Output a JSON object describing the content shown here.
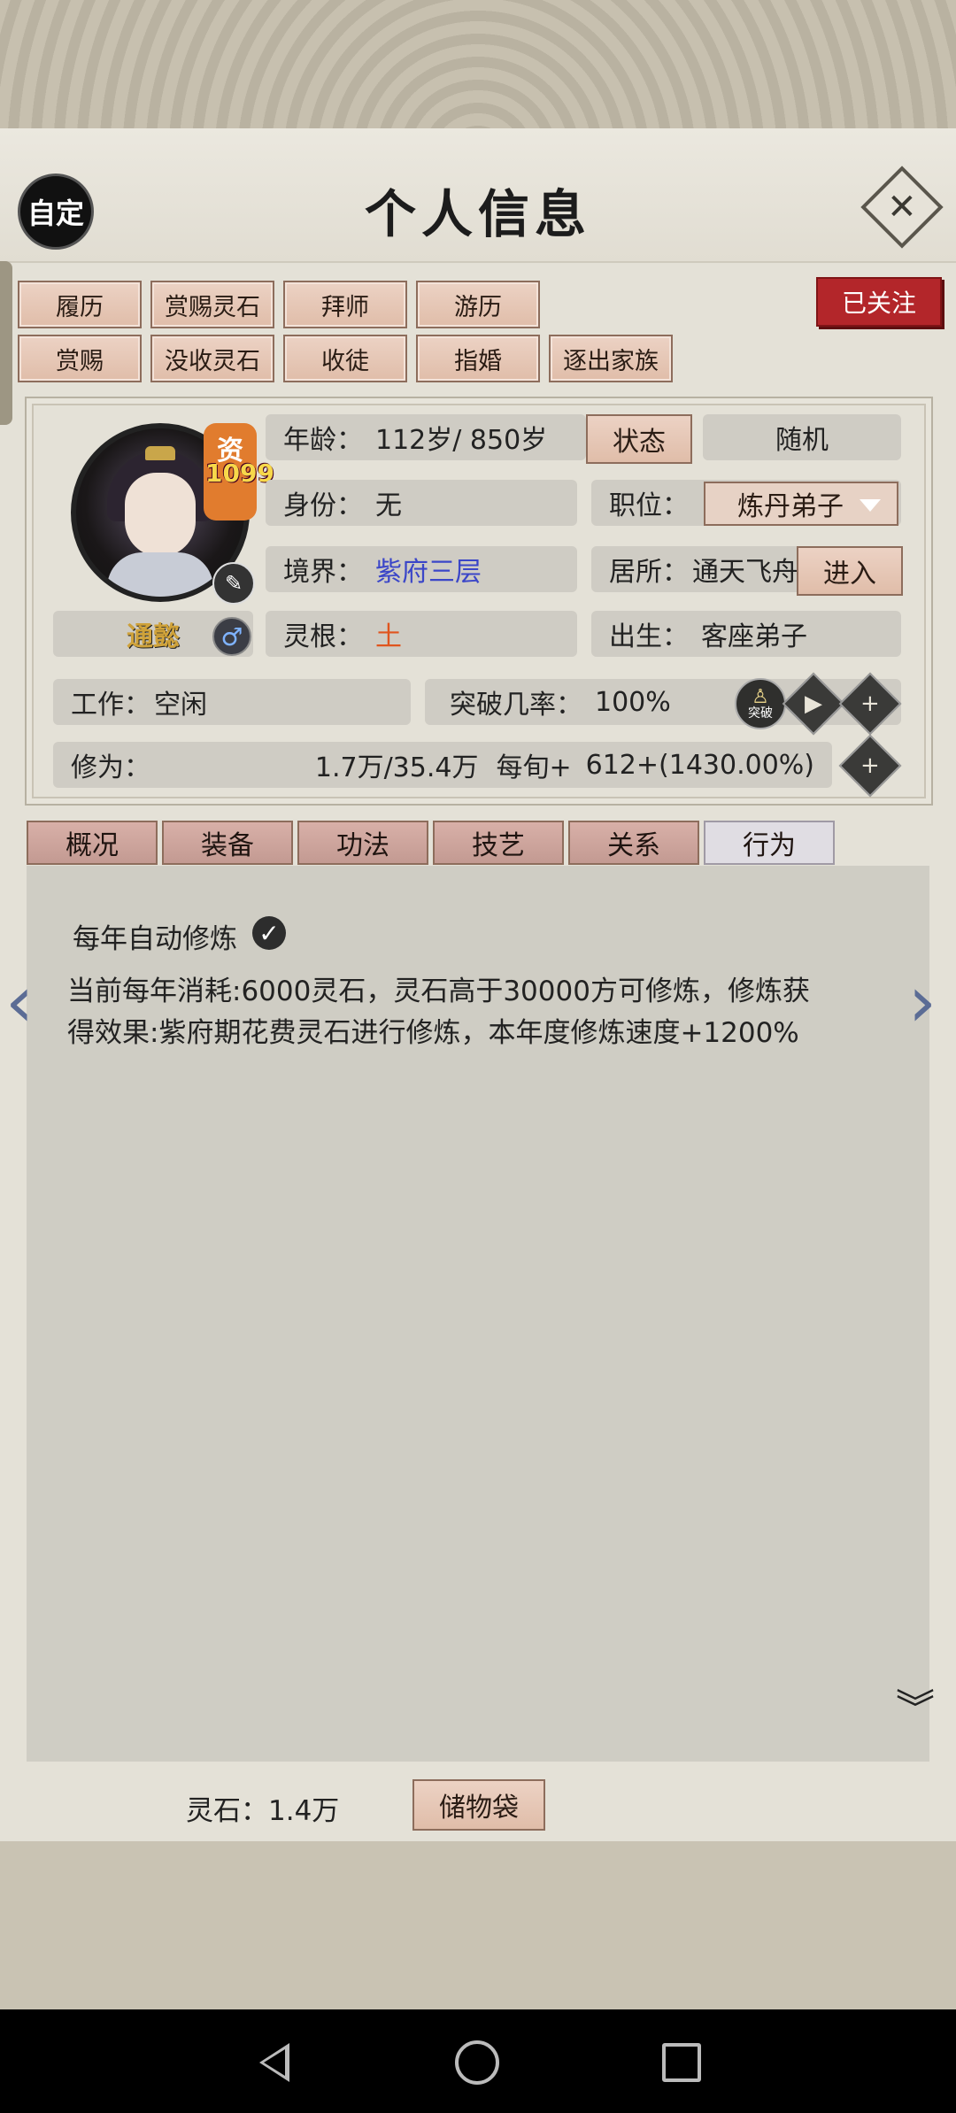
{
  "header": {
    "custom_label": "自定",
    "title": "个人信息",
    "close_glyph": "✕"
  },
  "actions_row1": [
    "履历",
    "赏赐灵石",
    "拜师",
    "游历"
  ],
  "actions_row2": [
    "赏赐",
    "没收灵石",
    "收徒",
    "指婚",
    "逐出家族"
  ],
  "follow_label": "已关注",
  "profile": {
    "aptitude_label": "资",
    "aptitude_value": "1099",
    "name": "通懿",
    "gender_symbol": "♂",
    "age_label": "年龄：",
    "age_value": "112岁/ 850岁",
    "status_button": "状态",
    "random_button": "随机",
    "identity_label": "身份：",
    "identity_value": "无",
    "position_label": "职位：",
    "position_value": "炼丹弟子",
    "realm_label": "境界：",
    "realm_value": "紫府三层",
    "residence_label": "居所：",
    "residence_value": "通天飞舟",
    "enter_button": "进入",
    "root_label": "灵根：",
    "root_value": "土",
    "birth_label": "出生：",
    "birth_value": "客座弟子",
    "work_label": "工作：",
    "work_value": "空闲",
    "breakthrough_label": "突破几率：",
    "breakthrough_value": "100%",
    "breakthrough_icon_text": "突破",
    "cultivation_label": "修为：",
    "cultivation_value": "1.7万/35.4万",
    "per_period_label": "每旬+",
    "per_period_value": "612+(1430.00%)"
  },
  "tabs": [
    "概况",
    "装备",
    "功法",
    "技艺",
    "关系",
    "行为"
  ],
  "active_tab": "行为",
  "behavior": {
    "auto_cultivate_label": "每年自动修炼",
    "auto_cultivate_checked": true,
    "description_line1": "当前每年消耗:6000灵石，灵石高于30000方可修炼，修炼获",
    "description_line2": "得效果:紫府期花费灵石进行修炼，本年度修炼速度+1200%"
  },
  "footer": {
    "stones_label": "灵石：1.4万",
    "bag_button": "储物袋"
  },
  "icons": {
    "prev": "chevron-left-icon",
    "next": "chevron-right-icon",
    "more": "double-chevron-down-icon",
    "play": "play-icon",
    "plus": "plus-icon"
  },
  "colors": {
    "follow_red": "#b3262a",
    "realm_blue": "#3b46c8",
    "root_orange": "#e0551e",
    "aptitude_orange": "#e17c2e"
  }
}
